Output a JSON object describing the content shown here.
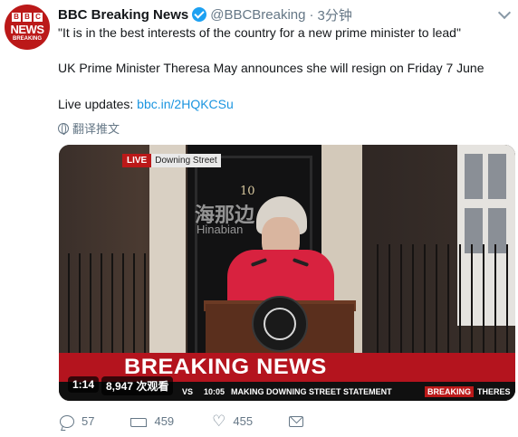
{
  "tweet": {
    "author": {
      "avatar_text": {
        "top": [
          "B",
          "B",
          "C"
        ],
        "middle": "NEWS",
        "bottom": "BREAKING"
      },
      "name": "BBC Breaking News",
      "handle": "@BBCBreaking",
      "separator": "·",
      "time": "3分钟",
      "verified": true
    },
    "text": {
      "line1": "\"It is in the best interests of the country for a new prime minister to lead\"",
      "line2": "UK Prime Minister Theresa May announces she will resign on Friday 7 June",
      "line3_prefix": "Live updates: ",
      "line3_link": "bbc.in/2HQKCSu"
    },
    "translate_label": "翻译推文",
    "video": {
      "live_label": "LIVE",
      "location_label": "Downing Street",
      "door_number": "10",
      "watermark_cn": "海那边",
      "watermark_en": "Hinabian",
      "breaking_label": "BREAKING NEWS",
      "ticker": {
        "left_fragment": "VS",
        "clock": "10:05",
        "headline": "MAKING DOWNING STREET STATEMENT",
        "badge": "BREAKING",
        "right_fragment": "THERES"
      },
      "duration": "1:14",
      "views": "8,947 次观看"
    },
    "actions": {
      "replies": "57",
      "retweets": "459",
      "likes": "455"
    }
  },
  "colors": {
    "bbc_red": "#bb1919",
    "link_blue": "#1b95e0",
    "verified_blue": "#1da1f2",
    "muted_gray": "#657786"
  },
  "icons": [
    "verified-badge-icon",
    "chevron-down-icon",
    "globe-icon",
    "reply-icon",
    "retweet-icon",
    "like-icon",
    "direct-message-icon"
  ]
}
